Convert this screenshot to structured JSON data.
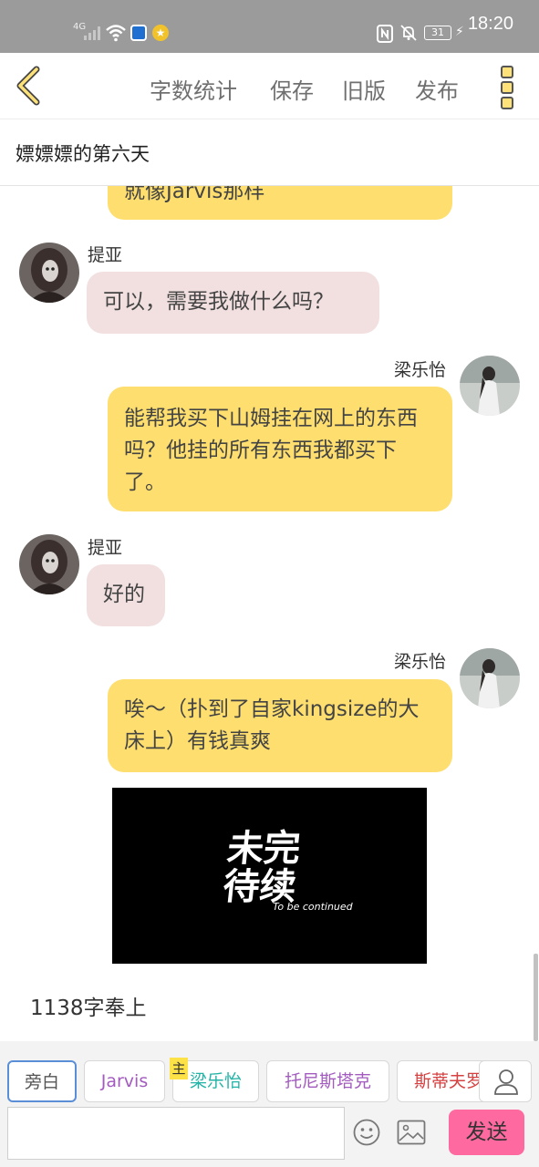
{
  "status_bar": {
    "network": "4G",
    "battery": "31",
    "time": "18:20"
  },
  "toolbar": {
    "word_count_label": "字数统计",
    "save_label": "保存",
    "old_version_label": "旧版",
    "publish_label": "发布",
    "back_icon": "chevron-left-icon",
    "more_icon": "more-vertical-icon"
  },
  "story": {
    "title": "嫖嫖嫖的第六天"
  },
  "messages": [
    {
      "speaker": "",
      "text": "就像Jarvis那样",
      "side": "right"
    },
    {
      "speaker": "提亚",
      "text": "可以，需要我做什么吗？",
      "side": "left"
    },
    {
      "speaker": "梁乐怡",
      "text": "能帮我买下山姆挂在网上的东西吗？他挂的所有东西我都买下了。",
      "side": "right"
    },
    {
      "speaker": "提亚",
      "text": "好的",
      "side": "left"
    },
    {
      "speaker": "梁乐怡",
      "text": "唉～（扑到了自家kingsize的大床上）有钱真爽",
      "side": "right"
    }
  ],
  "image_card": {
    "title_line1": "未完",
    "title_line2": "待续",
    "subtitle": "To be continued"
  },
  "footer_note": "1138字奉上",
  "characters": [
    {
      "label": "旁白",
      "color": "#555555",
      "selected": true
    },
    {
      "label": "Jarvis",
      "color": "#a35bbf",
      "selected": false
    },
    {
      "label": "梁乐怡",
      "color": "#23b3a6",
      "selected": false,
      "badge": "主"
    },
    {
      "label": "托尼斯塔克",
      "color": "#a35bbf",
      "selected": false
    },
    {
      "label": "斯蒂夫罗",
      "color": "#d64242",
      "selected": false
    }
  ],
  "composer": {
    "placeholder": "",
    "send_label": "发送",
    "accent_color": "#fe6aa0"
  },
  "colors": {
    "accent_yellow": "#fdde6e",
    "bubble_pink": "#f2e0e1"
  }
}
